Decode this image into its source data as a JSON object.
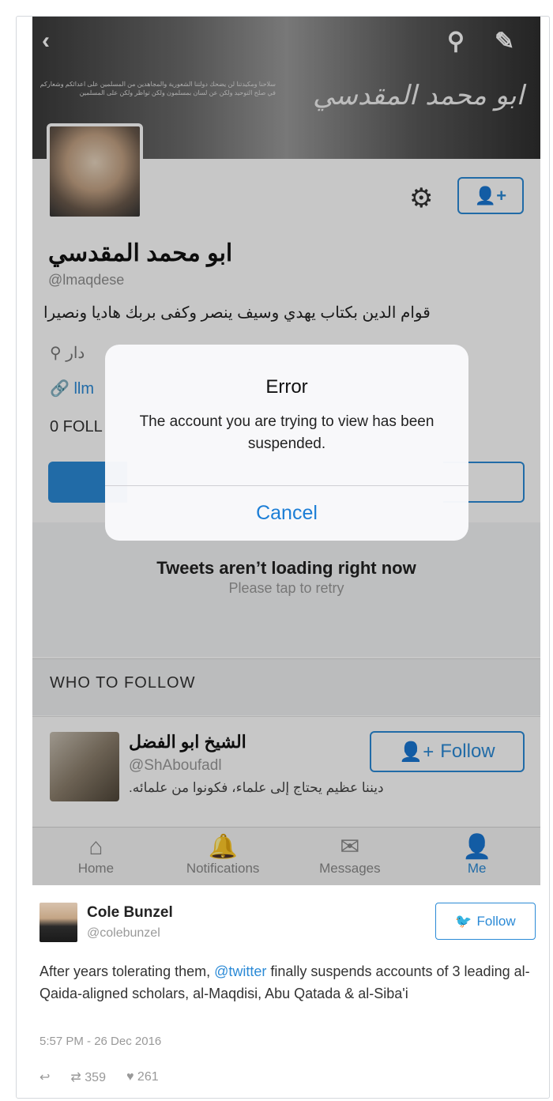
{
  "profile": {
    "name": "ابو محمد المقدسي",
    "handle": "@lmaqdese",
    "bio": "قوام الدين بكتاب يهدي وسيف ينصر وكفى بربك هاديا ونصيرا",
    "location_partial": "دار",
    "link_partial": "llm",
    "followers_partial": "0 FOLL",
    "banner_text": "سلاحنا ومكيدتنا لن يضحك دولتنا الشعورية والمجاهدين من المسلمين على اعدائكم وشعاركم في صلح التوحيد ولكن عن لسان بمسلمون ولكن تواظر ولكن على المسلمين",
    "banner_calligraphy": "ابو محمد المقدسي"
  },
  "dialog": {
    "title": "Error",
    "message": "The account you are trying to view has been suspended.",
    "cancel_label": "Cancel"
  },
  "tweets": {
    "title": "Tweets aren’t loading right now",
    "subtitle": "Please tap to retry"
  },
  "who_to_follow": {
    "label": "WHO TO FOLLOW",
    "suggestion": {
      "name": "الشيخ ابو الفضل",
      "handle": "@ShAboufadl",
      "bio": "ديننا عظيم يحتاج إلى علماء، فكونوا من علمائه.",
      "follow_label": "Follow"
    }
  },
  "tabbar": {
    "items": [
      {
        "label": "Home",
        "icon": "home-icon"
      },
      {
        "label": "Notifications",
        "icon": "bell-icon"
      },
      {
        "label": "Messages",
        "icon": "envelope-icon"
      },
      {
        "label": "Me",
        "icon": "person-icon"
      }
    ]
  },
  "embed": {
    "name": "Cole Bunzel",
    "handle": "@colebunzel",
    "follow_label": "Follow",
    "text_before": "After years tolerating them, ",
    "mention": "@twitter",
    "text_after": " finally suspends accounts of 3 leading al-Qaida-aligned scholars, al-Maqdisi, Abu Qatada & al-Siba'i",
    "timestamp": "5:57 PM - 26 Dec 2016",
    "retweets": "359",
    "likes": "261"
  },
  "colors": {
    "accent": "#2b8ad6",
    "dialog_button": "#1c7ed6"
  }
}
